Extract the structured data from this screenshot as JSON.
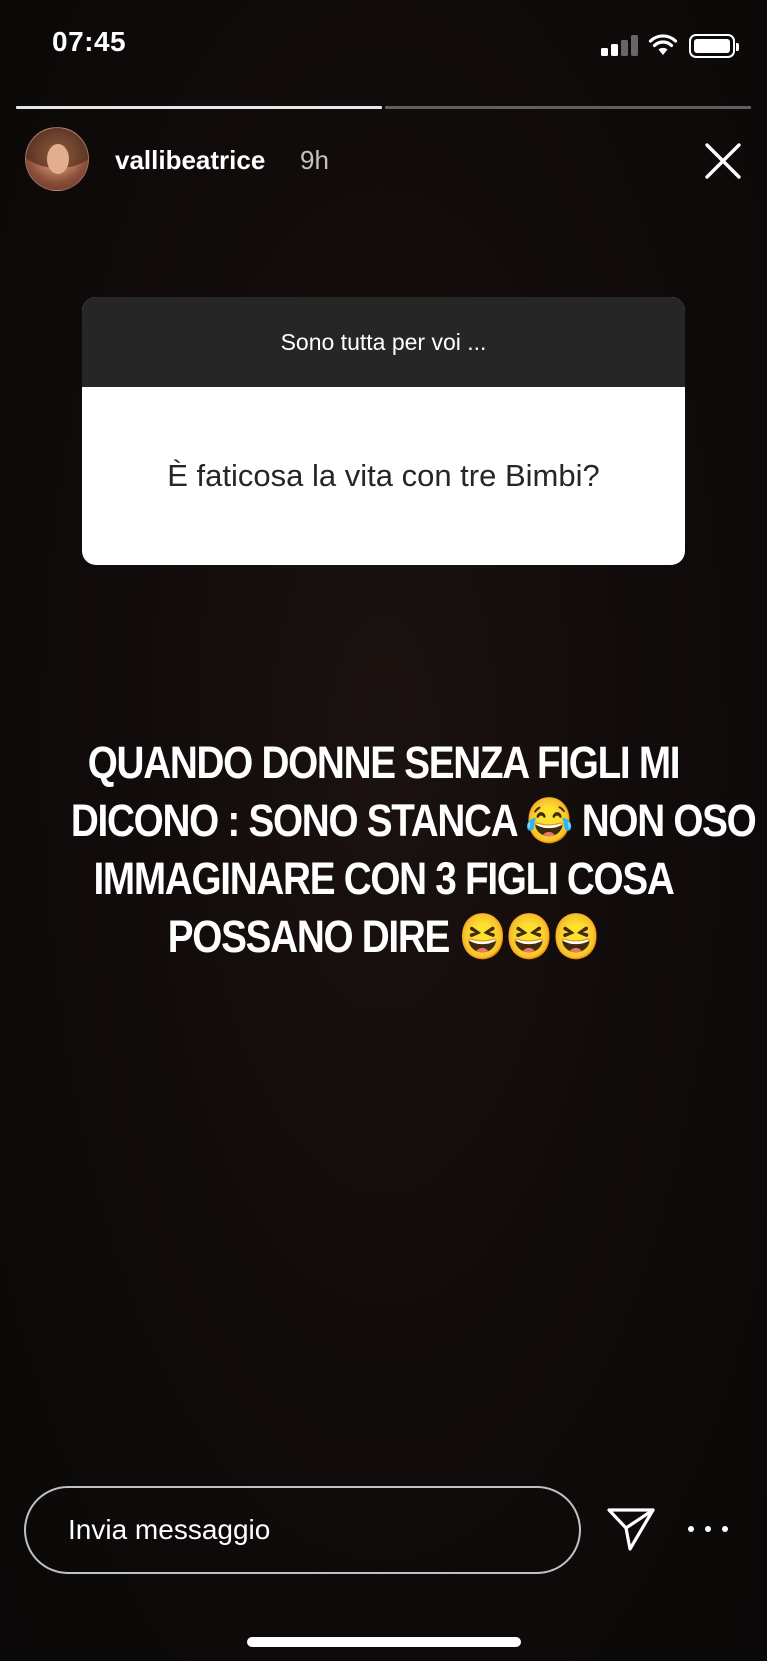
{
  "status_bar": {
    "time": "07:45",
    "signal_icon": "cellular-signal-icon",
    "wifi_icon": "wifi-icon",
    "battery_icon": "battery-icon"
  },
  "story": {
    "progress": {
      "total_segments": 2,
      "current_segment": 2
    },
    "username": "vallibeatrice",
    "time_ago": "9h",
    "avatar_icon": "profile-avatar",
    "close_icon": "close-icon"
  },
  "question_sticker": {
    "prompt": "Sono tutta per voi ...",
    "question": "È faticosa la vita con tre Bimbi?"
  },
  "story_text": {
    "lines": [
      "QUANDO DONNE SENZA FIGLI MI",
      "DICONO : SONO STANCA 😂 NON OSO",
      "IMMAGINARE CON 3 FIGLI COSA",
      "POSSANO DIRE 😆😆😆"
    ]
  },
  "footer": {
    "message_placeholder": "Invia messaggio",
    "send_icon": "paper-plane-icon",
    "more_icon": "more-horizontal-icon"
  },
  "colors": {
    "background": "#0a0808",
    "card_header": "#262626",
    "card_body": "#ffffff",
    "text_primary": "#ffffff"
  }
}
